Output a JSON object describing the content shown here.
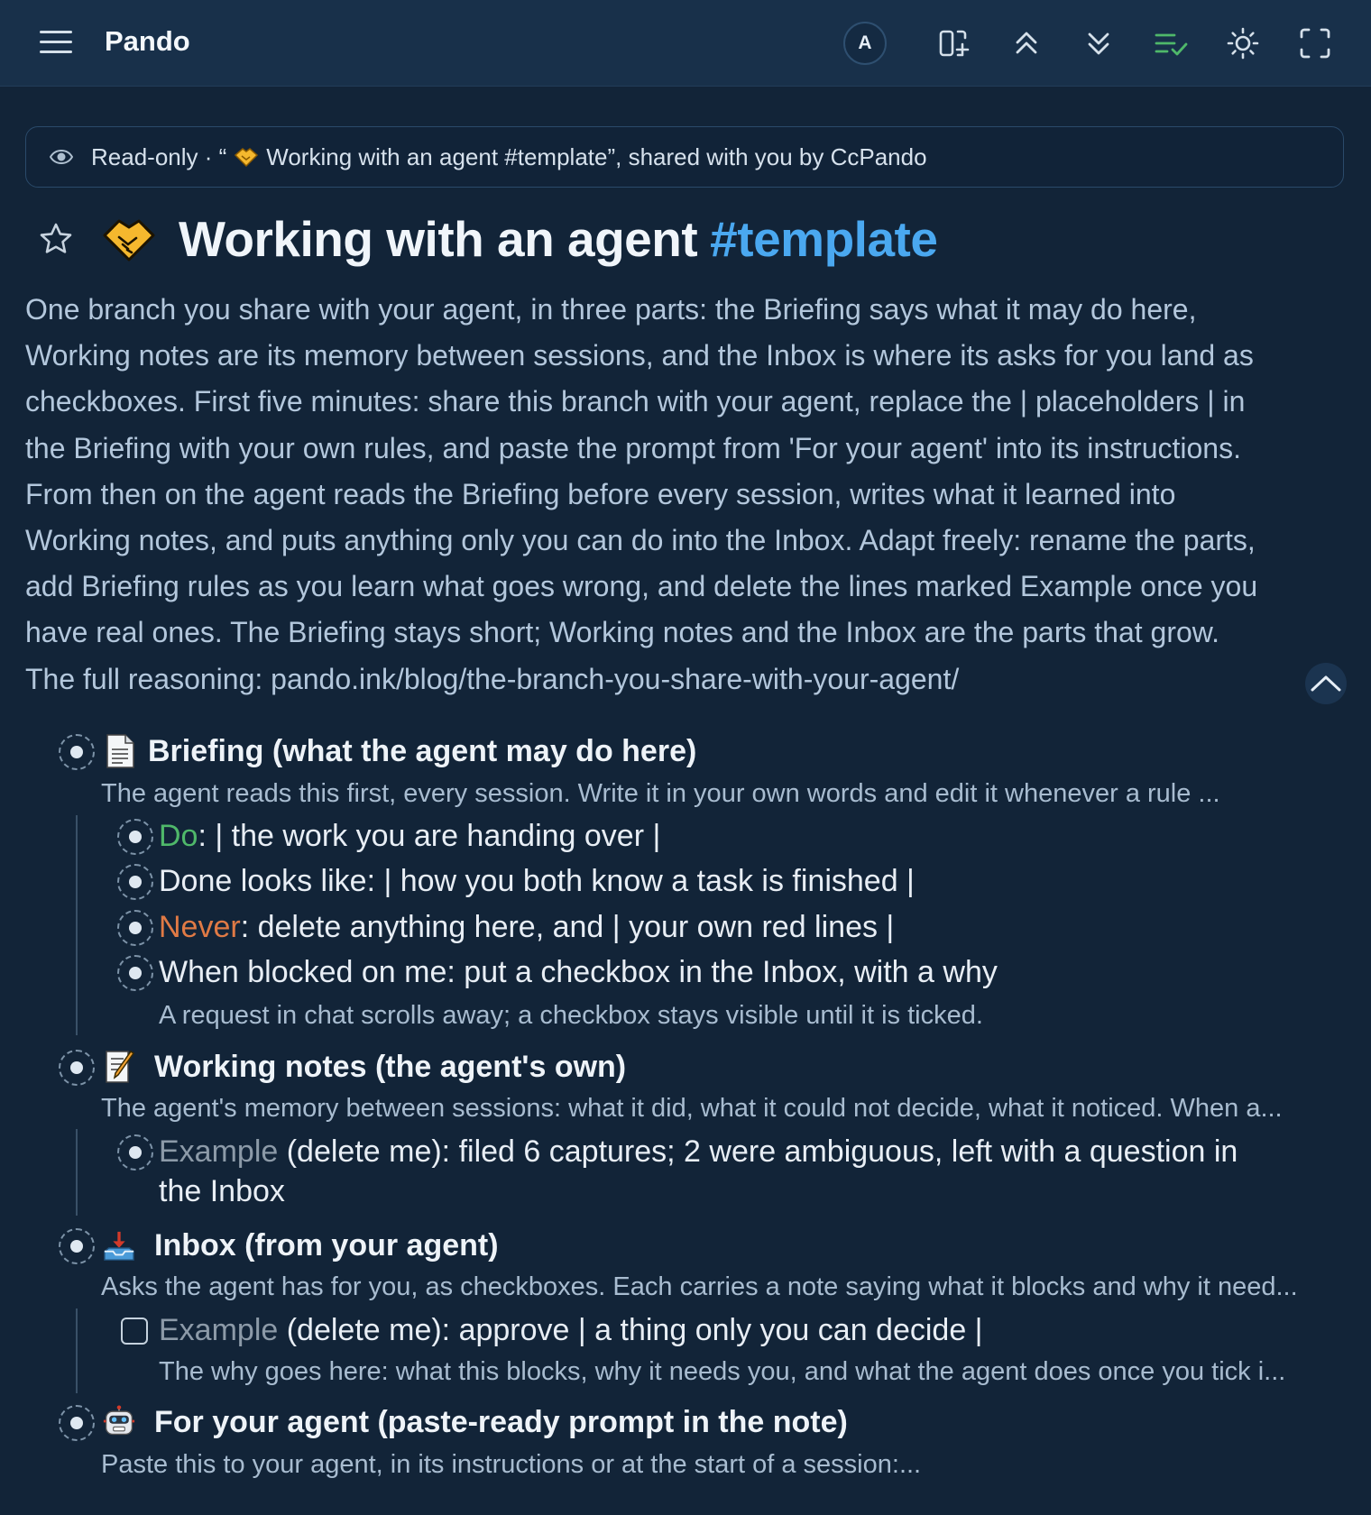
{
  "app": {
    "title": "Pando",
    "avatar_initial": "A"
  },
  "toolbar_icons": [
    "add-panel-icon",
    "collapse-all-icon",
    "expand-all-icon",
    "checklist-icon",
    "theme-sun-icon",
    "fullscreen-icon"
  ],
  "colors": {
    "accent_tag": "#4aa8f0",
    "do_label": "#4fb86a",
    "never_label": "#e07a45",
    "example_label": "#8c9aa8",
    "background": "#122438"
  },
  "banner": {
    "prefix": "Read-only · “",
    "suffix": " Working with an agent #template”, shared with you by CcPando"
  },
  "page": {
    "title": "Working with an agent",
    "tag": "#template",
    "description": "One branch you share with your agent, in three parts: the Briefing says what it may do here,\nWorking notes are its memory between sessions, and the Inbox is where its asks for you land as\ncheckboxes. First five minutes: share this branch with your agent, replace the | placeholders | in\nthe Briefing with your own rules, and paste the prompt from 'For your agent' into its instructions.\nFrom then on the agent reads the Briefing before every session, writes what it learned into\nWorking notes, and puts anything only you can do into the Inbox. Adapt freely: rename the parts,\nadd Briefing rules as you learn what goes wrong, and delete the lines marked Example once you\nhave real ones. The Briefing stays short; Working notes and the Inbox are the parts that grow.\nThe full reasoning: pando.ink/blog/the-branch-you-share-with-your-agent/"
  },
  "outline": {
    "briefing": {
      "icon": "document-icon",
      "title": "Briefing (what the agent may do here)",
      "note": "The agent reads this first, every session. Write it in your own words and edit it whenever a rule ...",
      "items": {
        "do_label": "Do",
        "do_rest": ": | the work you are handing over |",
        "done_text": "Done looks like: | how you both know a task is finished |",
        "never_label": "Never",
        "never_rest": ": delete anything here, and | your own red lines |",
        "blocked_text": "When blocked on me: put a checkbox in the Inbox, with a why",
        "blocked_note": "A request in chat scrolls away; a checkbox stays visible until it is ticked."
      }
    },
    "working_notes": {
      "icon": "memo-icon",
      "title": "Working notes (the agent's own)",
      "note": "The agent's memory between sessions: what it did, what it could not decide, what it noticed. When a...",
      "example_label": "Example",
      "example_rest_line1": " (delete me): filed 6 captures; 2 were ambiguous, left with a question in",
      "example_rest_line2": "the Inbox"
    },
    "inbox": {
      "icon": "inbox-tray-icon",
      "title": "Inbox (from your agent)",
      "note": "Asks the agent has for you, as checkboxes. Each carries a note saying what it blocks and why it need...",
      "example_label": "Example",
      "example_rest": " (delete me): approve | a thing only you can decide |",
      "example_checked": false,
      "example_note": "The why goes here: what this blocks, why it needs you, and what the agent does once you tick i..."
    },
    "for_agent": {
      "icon": "robot-icon",
      "title": "For your agent (paste-ready prompt in the note)",
      "note": "Paste this to your agent, in its instructions or at the start of a session:..."
    }
  }
}
